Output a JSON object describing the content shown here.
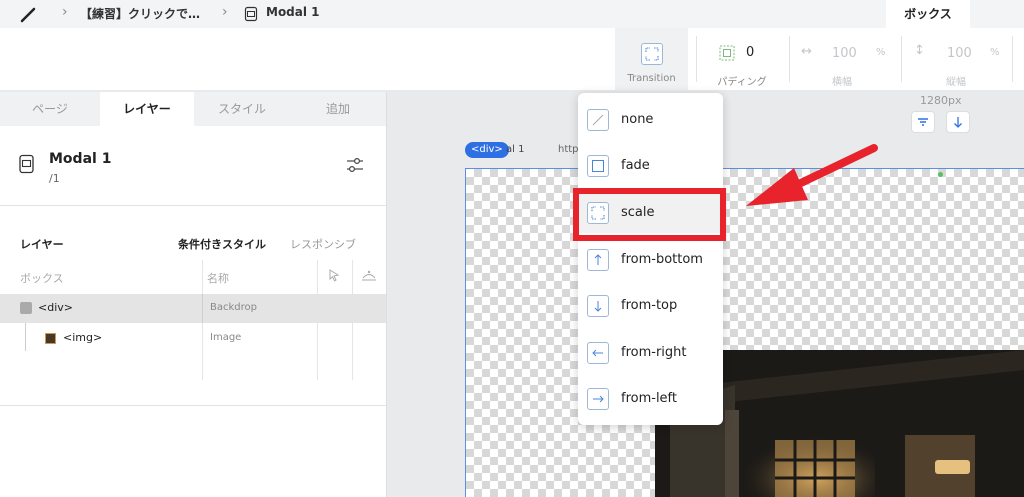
{
  "breadcrumb": {
    "item1": "【練習】クリックで…",
    "item2": "Modal 1"
  },
  "top_tab": {
    "label": "ボックス"
  },
  "toolbar": {
    "transition_label": "Transition",
    "padding_value": "0",
    "padding_label": "パディング",
    "width_value": "100",
    "width_unit": "%",
    "width_label": "横幅",
    "height_value": "100",
    "height_unit": "%",
    "height_label": "縦幅"
  },
  "left_tabs": [
    "ページ",
    "レイヤー",
    "スタイル",
    "追加"
  ],
  "component": {
    "name": "Modal 1",
    "path": "/1"
  },
  "layers": {
    "title": "レイヤー",
    "conditional": "条件付きスタイル",
    "responsive": "レスポンシブ",
    "col_box": "ボックス",
    "col_name": "名称",
    "rows": [
      {
        "tag": "<div>",
        "name": "Backdrop"
      },
      {
        "tag": "<img>",
        "name": "Image"
      }
    ]
  },
  "canvas": {
    "width_label": "1280px",
    "div_badge": "<div>",
    "label_suffix": "al 1",
    "url_fragment": "https"
  },
  "dropdown": {
    "options": [
      "none",
      "fade",
      "scale",
      "from-bottom",
      "from-top",
      "from-right",
      "from-left"
    ],
    "selected": "scale"
  },
  "colors": {
    "accent": "#2f6fe4",
    "highlight": "#e8232b",
    "selected_row": "#e4e4e4"
  }
}
